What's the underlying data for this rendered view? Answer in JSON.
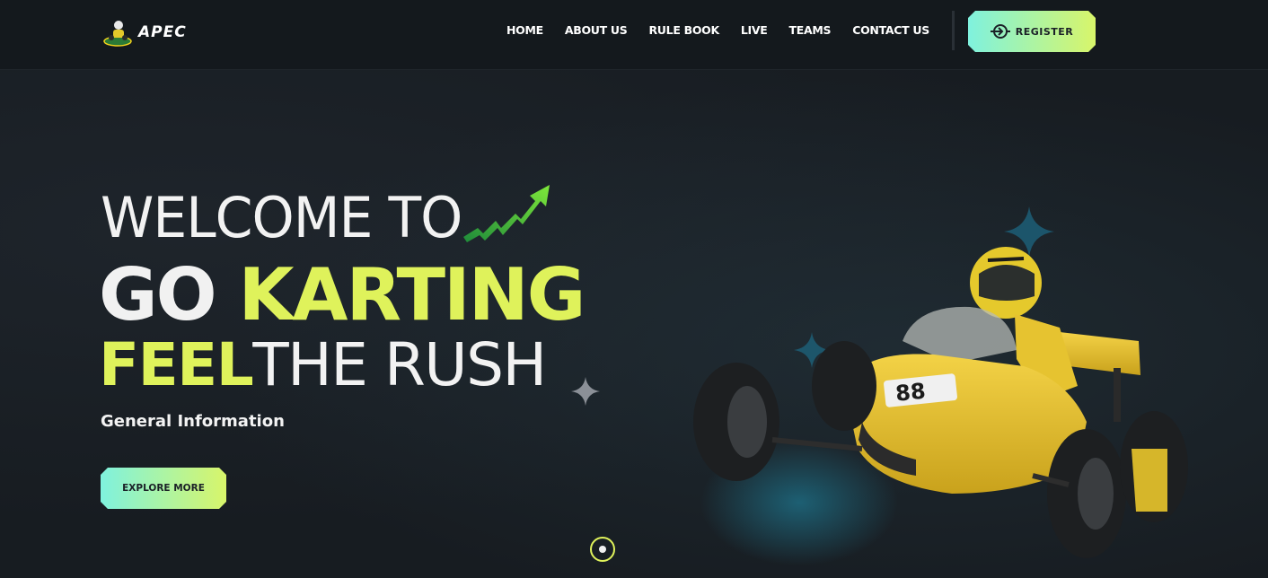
{
  "header": {
    "logo_text": "APEC",
    "nav": [
      "HOME",
      "ABOUT US",
      "RULE BOOK",
      "LIVE",
      "TEAMS",
      "CONTACT US"
    ],
    "register_label": "REGISTER"
  },
  "hero": {
    "welcome": "WELCOME TO",
    "go": "GO",
    "karting": "KARTING",
    "feel": "FEEL",
    "rush": "THE RUSH",
    "general_info": "General Information",
    "explore_label": "EXPLORE MORE",
    "kart_number": "88"
  },
  "colors": {
    "accent": "#dff25b",
    "button_gradient_start": "#7ff2de",
    "button_gradient_end": "#d8f56a",
    "background": "#171c21"
  }
}
